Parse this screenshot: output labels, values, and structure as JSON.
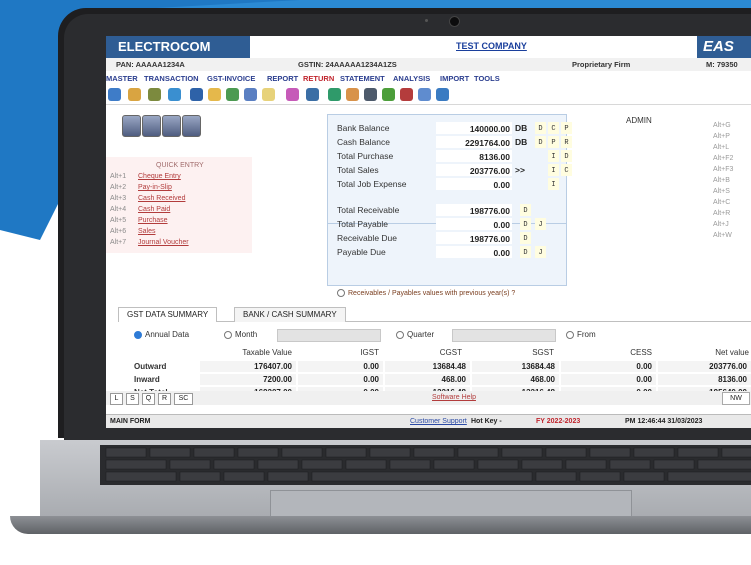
{
  "app": {
    "brand": "ELECTROCOM",
    "company": "TEST COMPANY",
    "brand_right": "EAS",
    "pan": "PAN: AAAAA1234A",
    "gstin": "GSTIN: 24AAAAA1234A1ZS",
    "firm_type": "Proprietary Firm",
    "mobile": "M: 79350"
  },
  "menu": [
    "MASTER",
    "TRANSACTION",
    "GST-INVOICE",
    "REPORT",
    "RETURN",
    "STATEMENT",
    "ANALYSIS",
    "IMPORT",
    "TOOLS"
  ],
  "quick_entry": {
    "title": "QUICK ENTRY",
    "items": [
      {
        "key": "Alt+1",
        "label": "Cheque Entry"
      },
      {
        "key": "Alt+2",
        "label": "Pay-in-Slip"
      },
      {
        "key": "Alt+3",
        "label": "Cash Received"
      },
      {
        "key": "Alt+4",
        "label": "Cash Paid"
      },
      {
        "key": "Alt+5",
        "label": "Purchase"
      },
      {
        "key": "Alt+6",
        "label": "Sales"
      },
      {
        "key": "Alt+7",
        "label": "Journal Voucher"
      }
    ]
  },
  "balances": {
    "rows": [
      {
        "label": "Bank Balance",
        "value": "140000.00",
        "drcr": "DB",
        "flags": [
          "D",
          "C",
          "P"
        ]
      },
      {
        "label": "Cash Balance",
        "value": "2291764.00",
        "drcr": "DB",
        "flags": [
          "D",
          "P",
          "R"
        ]
      },
      {
        "label": "Total Purchase",
        "value": "8136.00",
        "drcr": "",
        "flags": [
          "",
          "I",
          "D"
        ]
      },
      {
        "label": "Total Sales",
        "value": "203776.00",
        "drcr": ">>",
        "flags": [
          "",
          "I",
          "C"
        ]
      },
      {
        "label": "Total Job Expense",
        "value": "0.00",
        "drcr": "",
        "flags": [
          "",
          "I",
          ""
        ]
      },
      {
        "label": "Total Receivable",
        "value": "198776.00",
        "drcr": "",
        "flags": [
          "D",
          "",
          ""
        ]
      },
      {
        "label": "Total Payable",
        "value": "0.00",
        "drcr": "",
        "flags": [
          "D",
          "J",
          ""
        ]
      },
      {
        "label": "Receivable Due",
        "value": "198776.00",
        "drcr": "",
        "flags": [
          "D",
          "",
          ""
        ]
      },
      {
        "label": "Payable Due",
        "value": "0.00",
        "drcr": "",
        "flags": [
          "D",
          "J",
          ""
        ]
      }
    ],
    "note": "Receivables / Payables values with previous year(s) ?"
  },
  "user": "ADMIN",
  "alt_keys": [
    "Alt+G",
    "Alt+P",
    "Alt+L",
    "Alt+F2",
    "Alt+F3",
    "Alt+B",
    "Alt+S",
    "Alt+C",
    "Alt+R",
    "Alt+J",
    "Alt+W"
  ],
  "tabs": [
    "GST DATA SUMMARY",
    "BANK / CASH SUMMARY"
  ],
  "filters": {
    "annual": "Annual Data",
    "month": "Month",
    "quarter": "Quarter",
    "from": "From"
  },
  "gst_table": {
    "columns": [
      "Taxable Value",
      "IGST",
      "CGST",
      "SGST",
      "CESS",
      "Net value"
    ],
    "rows": [
      {
        "label": "Outward",
        "values": [
          "176407.00",
          "0.00",
          "13684.48",
          "13684.48",
          "0.00",
          "203776.00"
        ]
      },
      {
        "label": "Inward",
        "values": [
          "7200.00",
          "0.00",
          "468.00",
          "468.00",
          "0.00",
          "8136.00"
        ]
      },
      {
        "label": "Net Total",
        "values": [
          "169207.00",
          "0.00",
          "13216.48",
          "13216.48",
          "0.00",
          "195640.00"
        ]
      }
    ]
  },
  "bottom": {
    "buttons": [
      "L",
      "S",
      "Q",
      "R",
      "SC"
    ],
    "help": "Software Help",
    "nw": "NW"
  },
  "status": {
    "form": "MAIN FORM",
    "support": "Customer Support",
    "hotkey": "Hot Key -",
    "fy": "FY 2022-2023",
    "time": "PM 12:46:44 31/03/2023"
  }
}
